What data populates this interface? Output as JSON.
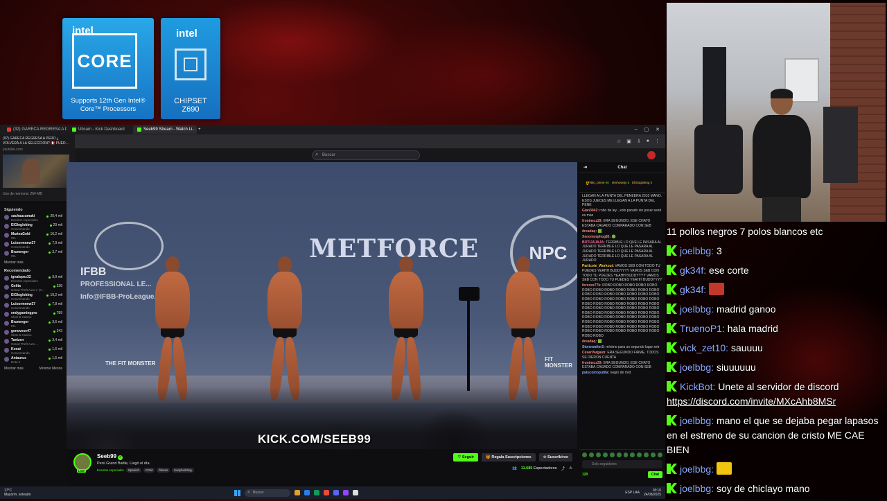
{
  "stickers": {
    "core": {
      "brand": "intel",
      "model": "CORE",
      "caption": "Supports 12th Gen Intel® Core™ Processors"
    },
    "chipset": {
      "brand": "intel",
      "caption_line1": "CHIPSET",
      "caption_line2": "Z690"
    }
  },
  "browser": {
    "tabs": [
      {
        "label": "(32) GARECA REGRESA A PERÚ",
        "active": false,
        "color": "#e53935"
      },
      {
        "label": "Ubcam - Kick Dashboard",
        "active": false,
        "color": "#53fc18"
      },
      {
        "label": "Seeb99 Stream - Watch Li...",
        "active": true,
        "color": "#53fc18"
      }
    ],
    "search_placeholder": "Buscar"
  },
  "yt_overlay": {
    "title": "(97) GARECA REGRESA A PERÚ ¿ VOLVERÁ A LA SELECCIÓN? 🇵🇪 PUED...",
    "site": "youtube.com",
    "memory": "Uso de memoria: 264 MB"
  },
  "sidebar": {
    "following_title": "Siguiendo",
    "following": [
      {
        "name": "sachauzumaki",
        "game": "Eventos especiales",
        "count": "20,4 mil"
      },
      {
        "name": "ElGlogloking",
        "game": "Conversando",
        "count": "20 mil"
      },
      {
        "name": "MarinaGold",
        "game": "IRL",
        "count": "16,2 mil"
      },
      {
        "name": "Luisormnew27",
        "game": "Conversando",
        "count": "7,9 mil"
      },
      {
        "name": "Brunenger",
        "game": "IRL",
        "count": "3,7 mil"
      }
    ],
    "more_label": "Mostrar más",
    "recommended_title": "Recomendado",
    "recommended": [
      {
        "name": "ignalopez32",
        "game": "Eventos especiales",
        "count": "9,9 mil"
      },
      {
        "name": "Geilta",
        "game": "Grand Theft Auto V (G...",
        "count": "328"
      },
      {
        "name": "ElGlogloking",
        "game": "Conversando",
        "count": "19,2 mil"
      },
      {
        "name": "Luisormnew27",
        "game": "Conversando",
        "count": "7,8 mil"
      },
      {
        "name": "endygamingpro",
        "game": "Slots & Casino",
        "count": "789"
      },
      {
        "name": "Brunenger",
        "game": "IRL",
        "count": "3,6 mil"
      },
      {
        "name": "genovese47",
        "game": "Slots & Casino",
        "count": "243"
      },
      {
        "name": "Tanizen",
        "game": "Grand Theft Auto ...",
        "count": "3,4 mil"
      },
      {
        "name": "Konai",
        "game": "Conversando",
        "count": "1,6 mil"
      },
      {
        "name": "Antaurus",
        "game": "Dota 2",
        "count": "1,5 mil"
      }
    ],
    "more_less": "Mostrar más",
    "more_less2": "Mostrar Menos"
  },
  "video": {
    "watermark": "KICK.COM/SEEB99",
    "backdrop_ifbb": "IFBB",
    "backdrop_ifbb_sub": "PROFESSIONAL LE...",
    "backdrop_ifbb_url": "Info@IFBB-ProLeague...",
    "backdrop_metforce": "METFORCE",
    "backdrop_npc": "NPC",
    "fit_monster_left": "THE FIT MONSTER",
    "fit_monster_right": "FIT MONSTER"
  },
  "chat": {
    "title": "Chat",
    "gifters": [
      {
        "rank": "1",
        "name": "Pitito_prime",
        "value": "50"
      },
      {
        "rank": "",
        "name": "nimhoviejo",
        "value": "5"
      },
      {
        "rank": "",
        "name": "ElGlogloking",
        "value": "5"
      }
    ],
    "messages": [
      {
        "user": "",
        "color": "#ddd",
        "text": "LLEGAN A LA PUNTA DEL PENEERA 2010 MANO. ESOS JUECES ME LLEGAN A LA PUNTA DEL PENE"
      },
      {
        "user": "Gian3042:",
        "color": "#f28b82",
        "text": "robo de ley , solo parado sin posar seeb es mas"
      },
      {
        "user": "froninezz29:",
        "color": "#f28b82",
        "text": "ERA SEGUNDO, ESE CHATO ESTABA CAGADO COMPARADO CON SEB"
      },
      {
        "user": "dreadaq:",
        "color": "#f28b82",
        "text": "🟩"
      },
      {
        "user": "Xenomorphog85:",
        "color": "#f28b82",
        "text": "🟢"
      },
      {
        "user": "BOTIJAJAJA:",
        "color": "#ff6b9e",
        "text": "TERRIBLE LO QUE LE PASARA AL JURADO TERRIBLE LO QUE LE PASARA AL JURADO TERRIBLE LO QUE LE PASARA AL JURADO TERRIBLE LO QUE LE PASARA AL JURADO"
      },
      {
        "user": "Particote_Workout:",
        "color": "#f5c84c",
        "text": "VAMOS SEB CON TODO TU PUEDES YEAHH BUDDYYYY VAMOS SEB CON TODO TU PUEDES YEAHH BUDDYYYY VAMOS SEB CON TODO TU PUEDES YEAHH BUDDYYYY"
      },
      {
        "user": "forxxxx77k:",
        "color": "#f28b82",
        "text": "ROBO ROBO ROBO ROBO ROBO ROBO ROBO ROBO ROBO ROBO ROBO ROBO ROBO ROBO ROBO ROBO ROBO ROBO ROBO ROBO ROBO ROBO ROBO ROBO ROBO ROBO ROBO ROBO ROBO ROBO ROBO ROBO ROBO ROBO ROBO ROBO ROBO ROBO ROBO ROBO ROBO ROBO ROBO ROBO ROBO ROBO ROBO ROBO ROBO ROBO ROBO ROBO ROBO ROBO ROBO ROBO ROBO ROBO ROBO ROBO ROBO ROBO ROBO ROBO ROBO ROBO ROBO ROBO ROBO ROBO ROBO ROBO ROBO ROBO ROBO ROBO ROBO"
      },
      {
        "user": "dreadaq:",
        "color": "#f28b82",
        "text": "🟩"
      },
      {
        "user": "Stonewalter2:",
        "color": "#8fa8ff",
        "text": "mínimo para un segundo lugar seb"
      },
      {
        "user": "CesarVargasb:",
        "color": "#f28b82",
        "text": "ERA SEGUNDO FIRME, TODOS SE DIERON CUENTA"
      },
      {
        "user": "froninezz29:",
        "color": "#f28b82",
        "text": "ERA SEGUNDO, ESE CHATO ESTABA CAGADO COMPARADO CON SEB"
      },
      {
        "user": "patucomoputita:",
        "color": "#8fa8ff",
        "text": "negro de mrd"
      }
    ],
    "input_placeholder": "Solo seguidores",
    "points": "120",
    "send_label": "Chat"
  },
  "stream_info": {
    "channel": "Seeb99",
    "live_badge": "LIVE",
    "title": "Perú Grand Battle, Llegó el día.",
    "category": "Eventos especiales",
    "tags": [
      "Spanish",
      "GYM",
      "fitness",
      "bodybuilding"
    ],
    "follow_label": "Seguir",
    "gift_label": "Regala Suscripciones",
    "subscribe_label": "Suscribirse",
    "viewers": "11.685",
    "viewers_label": "Espectadores"
  },
  "taskbar": {
    "weather_temp": "17°C",
    "weather_desc": "Mayorm. soleado",
    "search": "Buscar",
    "lang": "ESP LAA",
    "time": "18:10",
    "date": "24/08/2025"
  },
  "big_chat": [
    {
      "user": "",
      "text": "11 pollos negros 7 polos blancos etc",
      "badge": false
    },
    {
      "user": "joelbbg:",
      "text": "3",
      "badge": true
    },
    {
      "user": "gk34f:",
      "text": "ese corte",
      "badge": true
    },
    {
      "user": "gk34f:",
      "text": "",
      "badge": true,
      "emote": "#c0392b"
    },
    {
      "user": "joelbbg:",
      "text": "madrid ganoo",
      "badge": true
    },
    {
      "user": "TruenoP1:",
      "text": "hala madrid",
      "badge": true
    },
    {
      "user": "vick_zet10:",
      "text": "sauuuu",
      "badge": true
    },
    {
      "user": "joelbbg:",
      "text": "siuuuuuu",
      "badge": true
    },
    {
      "user": "KickBot:",
      "text": "Unete al servidor de discord",
      "badge": true,
      "link": "https://discord.com/invite/MXcAhb8MSr"
    },
    {
      "user": "joelbbg:",
      "text": "mano el que se dejaba pegar lapasos en el estreno de su cancion de cristo ME CAE BIEN",
      "badge": true
    },
    {
      "user": "joelbbg:",
      "text": "",
      "badge": true,
      "emote": "#f1c40f"
    },
    {
      "user": "joelbbg:",
      "text": "soy de chiclayo mano",
      "badge": true
    }
  ]
}
